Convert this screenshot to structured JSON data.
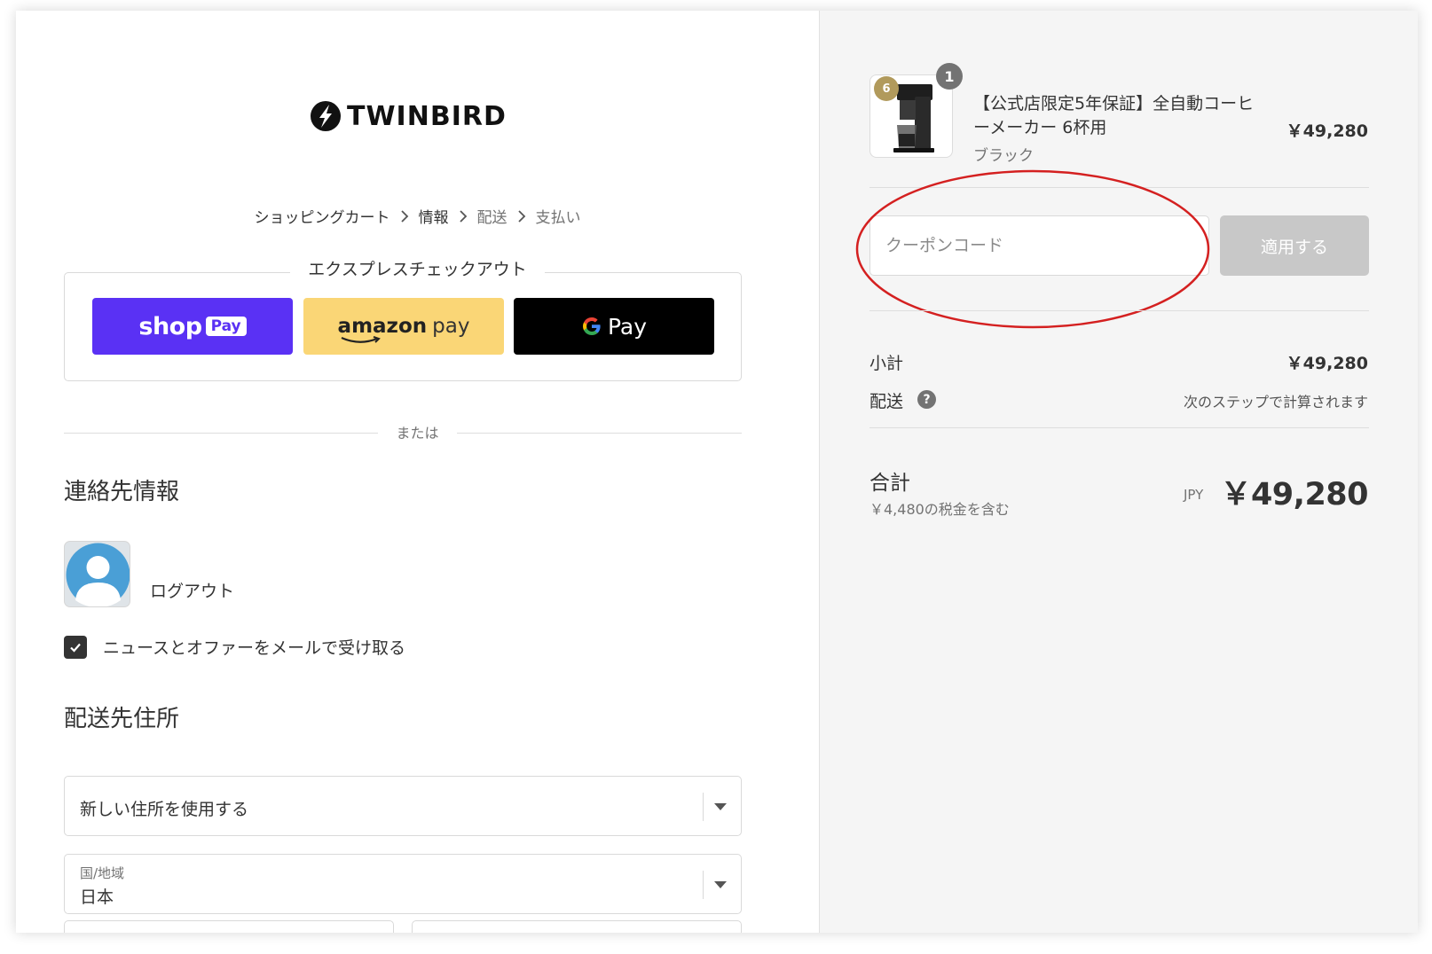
{
  "brand": {
    "name": "TWINBIRD"
  },
  "breadcrumb": [
    {
      "label": "ショッピングカート",
      "muted": false
    },
    {
      "label": "情報",
      "muted": false
    },
    {
      "label": "配送",
      "muted": true
    },
    {
      "label": "支払い",
      "muted": true
    }
  ],
  "express": {
    "label": "エクスプレスチェックアウト",
    "shop_pay": {
      "word": "shop",
      "badge": "Pay",
      "color": "#5a31f4"
    },
    "amazon_pay": {
      "word": "amazon",
      "suffix": "pay",
      "color": "#fad676"
    },
    "google_pay": {
      "suffix": "Pay",
      "color": "#000000"
    }
  },
  "divider": {
    "or": "または"
  },
  "contact": {
    "title": "連絡先情報",
    "logout": "ログアウト",
    "newsletter_label": "ニュースとオファーをメールで受け取る",
    "newsletter_checked": true
  },
  "shipping": {
    "title": "配送先住所",
    "address_select": {
      "value": "新しい住所を使用する"
    },
    "country_select": {
      "label": "国/地域",
      "value": "日本"
    }
  },
  "summary": {
    "product": {
      "name": "【公式店限定5年保証】全自動コーヒーメーカー 6杯用",
      "variant": "ブラック",
      "price": "￥49,280",
      "quantity": "1",
      "cup_badge": "6"
    },
    "coupon": {
      "placeholder": "クーポンコード",
      "apply_label": "適用する"
    },
    "subtotal": {
      "label": "小計",
      "value": "￥49,280"
    },
    "shipping": {
      "label": "配送",
      "value": "次のステップで計算されます"
    },
    "total": {
      "label": "合計",
      "tax": "￥4,480の税金を含む",
      "currency": "JPY",
      "amount": "￥49,280"
    }
  },
  "colors": {
    "annotation": "#d42020",
    "accent_dark": "#333333"
  }
}
